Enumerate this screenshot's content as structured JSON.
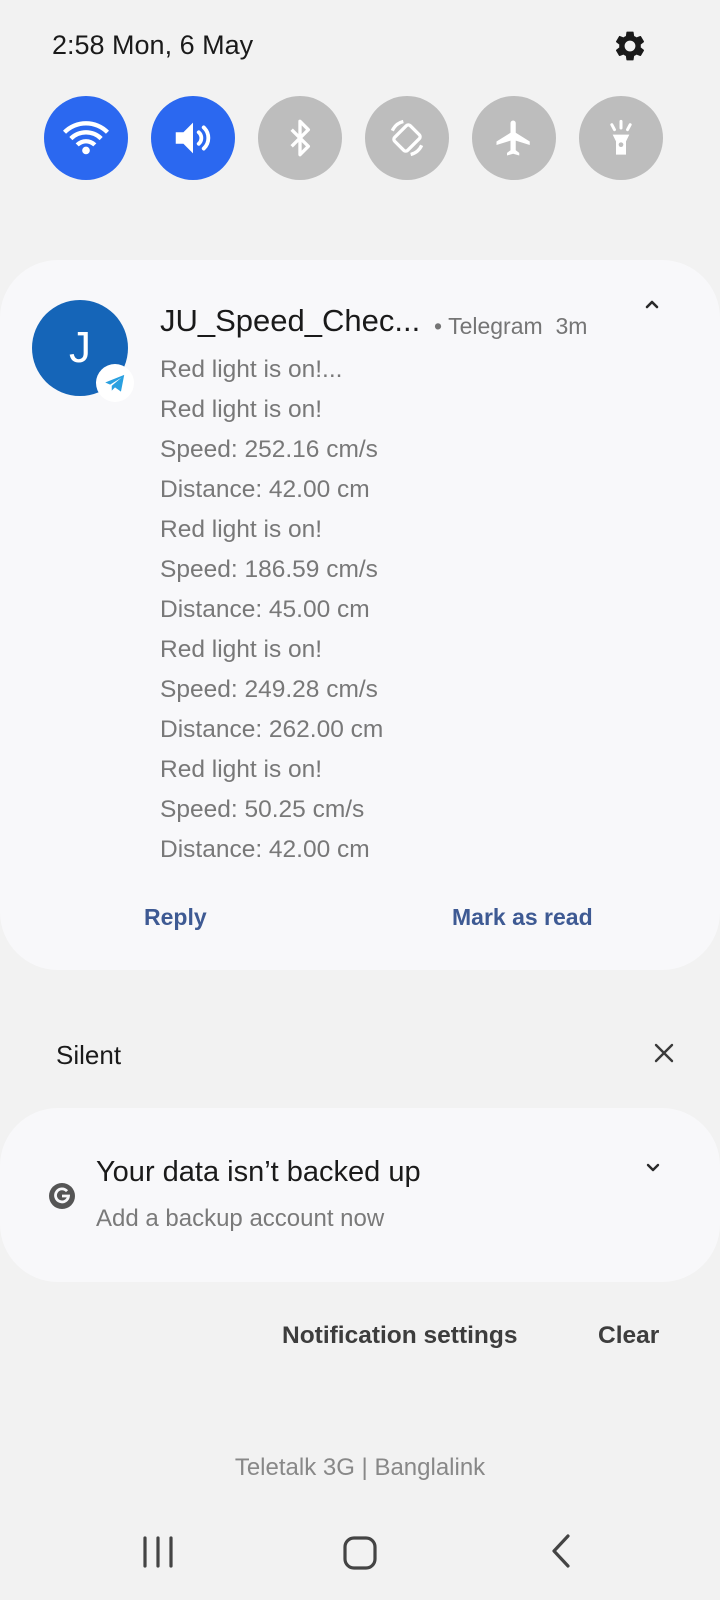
{
  "status_bar": {
    "time_date": "2:58 Mon, 6 May"
  },
  "quick_settings": [
    {
      "name": "wifi",
      "state": "on",
      "icon": "wifi-icon"
    },
    {
      "name": "sound",
      "state": "on",
      "icon": "volume-icon"
    },
    {
      "name": "bluetooth",
      "state": "off",
      "icon": "bluetooth-icon"
    },
    {
      "name": "auto-rotate",
      "state": "off",
      "icon": "rotate-icon"
    },
    {
      "name": "airplane-mode",
      "state": "off",
      "icon": "airplane-icon"
    },
    {
      "name": "flashlight",
      "state": "off",
      "icon": "flashlight-icon"
    }
  ],
  "message_notification": {
    "avatar_letter": "J",
    "sender": "JU_Speed_Chec...",
    "app": "Telegram",
    "age": "3m",
    "lines": [
      "Red light is on!...",
      "Red light is on!",
      "Speed: 252.16 cm/s",
      "Distance: 42.00 cm",
      "Red light is on!",
      "Speed: 186.59 cm/s",
      "Distance: 45.00 cm",
      "Red light is on!",
      "Speed: 249.28 cm/s",
      "Distance: 262.00 cm",
      "Red light is on!",
      "Speed: 50.25 cm/s",
      "Distance: 42.00 cm"
    ],
    "actions": {
      "reply": "Reply",
      "mark_read": "Mark as read"
    }
  },
  "silent_section": {
    "label": "Silent",
    "backup_notification": {
      "title": "Your data isn’t backed up",
      "subtitle": "Add a backup account now"
    }
  },
  "footer": {
    "notification_settings": "Notification settings",
    "clear": "Clear",
    "carrier": "Teletalk 3G | Banglalink"
  },
  "colors": {
    "active_toggle": "#2b68f0",
    "inactive_toggle": "#bdbdbd",
    "avatar": "#1565b8",
    "action_text": "#3e5a93",
    "telegram": "#2aa0e0"
  }
}
